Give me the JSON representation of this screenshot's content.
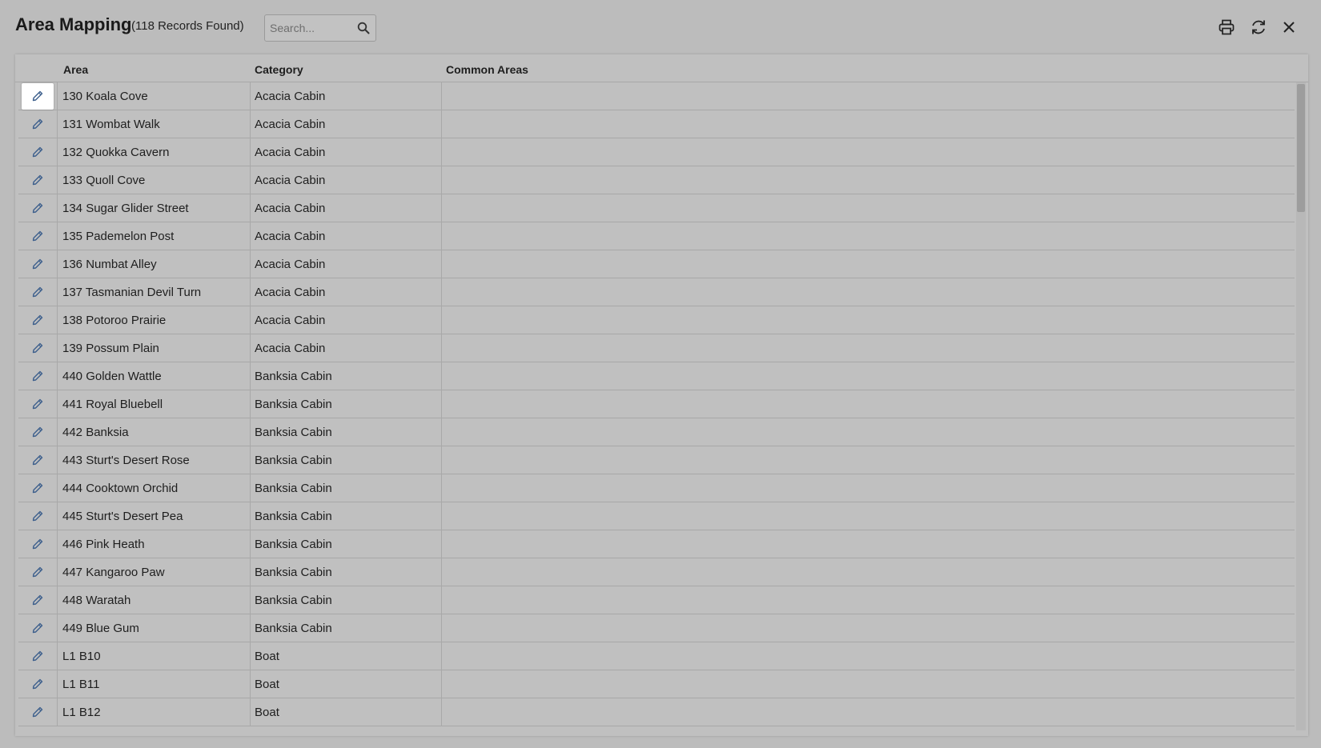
{
  "header": {
    "title": "Area Mapping",
    "record_count": "(118 Records Found)",
    "search_placeholder": "Search...",
    "search_value": ""
  },
  "table": {
    "columns": [
      "Area",
      "Category",
      "Common Areas"
    ],
    "rows": [
      {
        "area": "130 Koala Cove",
        "category": "Acacia Cabin",
        "common": ""
      },
      {
        "area": "131 Wombat Walk",
        "category": "Acacia Cabin",
        "common": ""
      },
      {
        "area": "132 Quokka Cavern",
        "category": "Acacia Cabin",
        "common": ""
      },
      {
        "area": "133 Quoll Cove",
        "category": "Acacia Cabin",
        "common": ""
      },
      {
        "area": "134 Sugar Glider Street",
        "category": "Acacia Cabin",
        "common": ""
      },
      {
        "area": "135 Pademelon Post",
        "category": "Acacia Cabin",
        "common": ""
      },
      {
        "area": "136 Numbat Alley",
        "category": "Acacia Cabin",
        "common": ""
      },
      {
        "area": "137 Tasmanian Devil Turn",
        "category": "Acacia Cabin",
        "common": ""
      },
      {
        "area": "138 Potoroo Prairie",
        "category": "Acacia Cabin",
        "common": ""
      },
      {
        "area": "139 Possum Plain",
        "category": "Acacia Cabin",
        "common": ""
      },
      {
        "area": "440 Golden Wattle",
        "category": "Banksia Cabin",
        "common": ""
      },
      {
        "area": "441 Royal Bluebell",
        "category": "Banksia Cabin",
        "common": ""
      },
      {
        "area": "442 Banksia",
        "category": "Banksia Cabin",
        "common": ""
      },
      {
        "area": "443 Sturt's Desert Rose",
        "category": "Banksia Cabin",
        "common": ""
      },
      {
        "area": "444 Cooktown Orchid",
        "category": "Banksia Cabin",
        "common": ""
      },
      {
        "area": "445 Sturt's Desert Pea",
        "category": "Banksia Cabin",
        "common": ""
      },
      {
        "area": "446 Pink Heath",
        "category": "Banksia Cabin",
        "common": ""
      },
      {
        "area": "447 Kangaroo Paw",
        "category": "Banksia Cabin",
        "common": ""
      },
      {
        "area": "448 Waratah",
        "category": "Banksia Cabin",
        "common": ""
      },
      {
        "area": "449 Blue Gum",
        "category": "Banksia Cabin",
        "common": ""
      },
      {
        "area": "L1 B10",
        "category": "Boat",
        "common": ""
      },
      {
        "area": "L1 B11",
        "category": "Boat",
        "common": ""
      },
      {
        "area": "L1 B12",
        "category": "Boat",
        "common": ""
      }
    ]
  },
  "icons": {
    "search": "search-icon",
    "print": "printer-icon",
    "refresh": "refresh-icon",
    "close": "close-icon",
    "edit": "pencil-icon"
  },
  "colors": {
    "background": "#bcbcbc",
    "panel": "#c0c0c0",
    "icon_blue": "#3d5f8c",
    "active_edit": "#ffffff"
  }
}
